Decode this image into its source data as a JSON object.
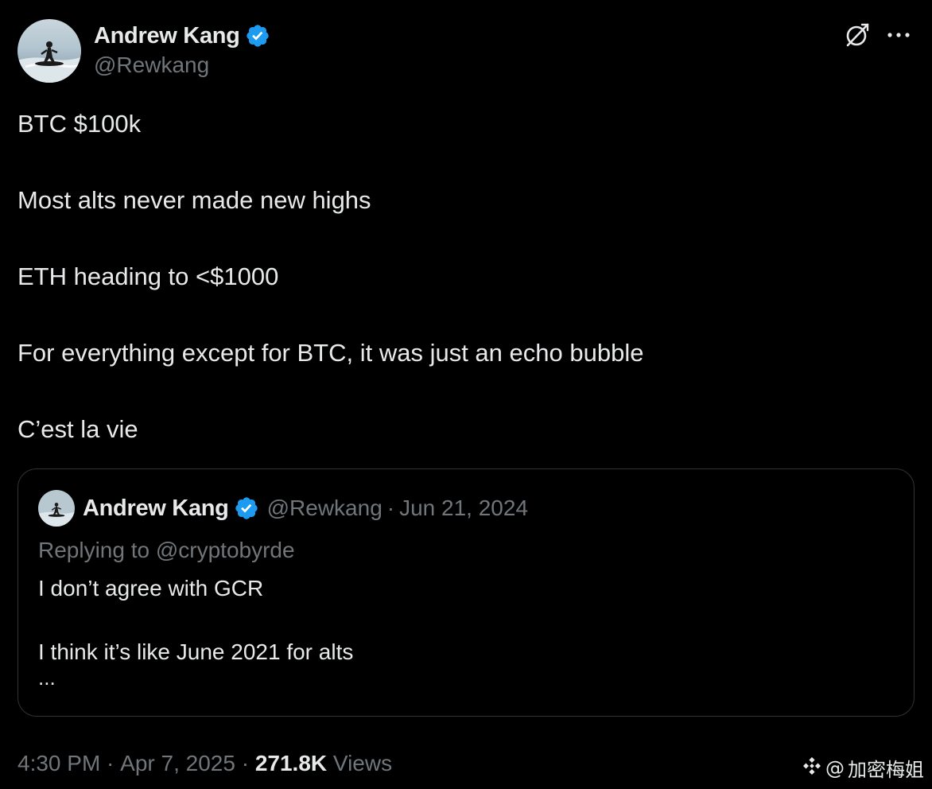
{
  "author": {
    "display_name": "Andrew Kang",
    "handle": "@Rewkang",
    "verified": true
  },
  "header_actions": {
    "grok_icon": "grok-icon",
    "more_icon": "more-horizontal-icon"
  },
  "tweet": {
    "lines": [
      "BTC $100k",
      "Most alts never made new highs",
      "ETH heading to <$1000",
      "For everything except for BTC, it was just an echo bubble",
      "C’est la vie"
    ]
  },
  "quote": {
    "display_name": "Andrew Kang",
    "handle": "@Rewkang",
    "separator": "·",
    "date": "Jun 21, 2024",
    "replying_to": "Replying to @cryptobyrde",
    "lines": [
      "I don’t agree with GCR",
      "I think it’s like June 2021 for alts"
    ],
    "ellipsis": "..."
  },
  "meta": {
    "time": "4:30 PM",
    "separator": " · ",
    "date": "Apr 7, 2025",
    "views_count": "271.8K",
    "views_label": " Views"
  },
  "watermark": {
    "at": "@",
    "text": "加密梅姐"
  },
  "colors": {
    "background": "#000000",
    "text_primary": "#e7e9ea",
    "text_secondary": "#71767b",
    "border": "#2f3336",
    "verified_blue": "#1d9bf0"
  }
}
